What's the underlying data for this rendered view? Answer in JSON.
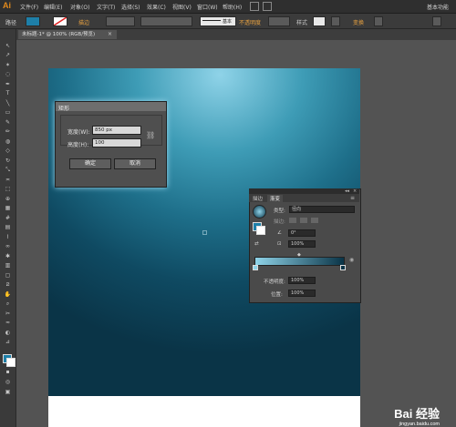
{
  "menubar": {
    "logo": "Ai",
    "items": [
      "文件(F)",
      "编辑(E)",
      "对象(O)",
      "文字(T)",
      "选择(S)",
      "效果(C)",
      "视图(V)",
      "窗口(W)",
      "帮助(H)"
    ],
    "workspace": "基本功能"
  },
  "controlbar": {
    "path_label": "路径",
    "stroke_label": "描边",
    "stroke_weight": "基本",
    "opacity_label": "不透明度",
    "style_label": "样式",
    "transform_label": "变换"
  },
  "document": {
    "tab_title": "未标题-1* @ 100% (RGB/预览)"
  },
  "dialog": {
    "title": "矩形",
    "width_label": "宽度(W):",
    "width_value": "850 px",
    "height_label": "高度(H):",
    "height_value": "100",
    "ok_label": "确定",
    "cancel_label": "取消"
  },
  "gradient_panel": {
    "tabs": [
      "描边",
      "渐变"
    ],
    "type_label": "类型:",
    "type_value": "径向",
    "stroke_label": "描边:",
    "angle_value": "0°",
    "ratio_value": "100%",
    "opacity_label": "不透明度:",
    "opacity_value": "100%",
    "position_label": "位置:",
    "position_value": "100%",
    "gradient_start": "#8fd3e8",
    "gradient_end": "#0a3447"
  },
  "watermark": {
    "text": "Bai 经验",
    "subtext": "jingyan.baidu.com"
  }
}
